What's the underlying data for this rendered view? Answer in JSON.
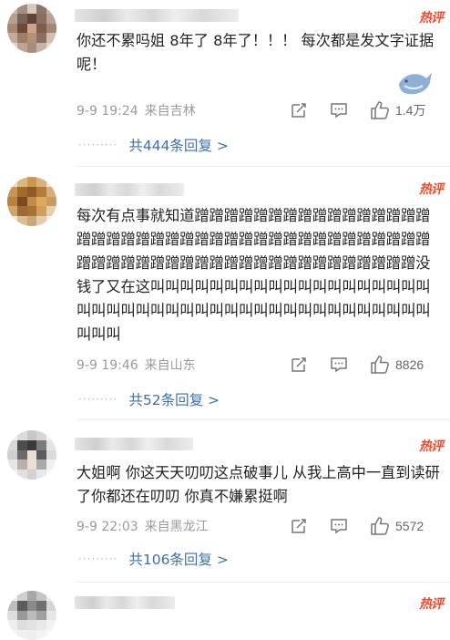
{
  "comments": [
    {
      "badge": "热评",
      "text": "你还不累吗姐 8年了 8年了！！！ 每次都是发文字证据呢！",
      "time": "9-9 19:24",
      "location": "来自吉林",
      "likes": "1.4万",
      "reply_text": "共444条回复 >",
      "avatar_icon": "blurred-avatar-icon"
    },
    {
      "badge": "热评",
      "text": "每次有点事就知道蹭蹭蹭蹭蹭蹭蹭蹭蹭蹭蹭蹭蹭蹭蹭蹭蹭蹭蹭蹭蹭蹭蹭蹭蹭蹭蹭蹭蹭蹭蹭蹭蹭蹭蹭蹭蹭蹭蹭蹭蹭蹭蹭蹭蹭蹭蹭蹭蹭蹭蹭蹭蹭蹭蹭蹭蹭蹭蹭蹭蹭蹭蹭没钱了又在这叫叫叫叫叫叫叫叫叫叫叫叫叫叫叫叫叫叫叫叫叫叫叫叫叫叫叫叫叫叫叫叫叫叫叫叫叫叫叫叫叫叫叫叫叫叫",
      "time": "9-9 19:46",
      "location": "来自山东",
      "likes": "8826",
      "reply_text": "共52条回复 >",
      "avatar_icon": "blurred-avatar-icon"
    },
    {
      "badge": "热评",
      "text": "大姐啊 你这天天叨叨这点破事儿 从我上高中一直到读研了你都还在叨叨 你真不嫌累挺啊",
      "time": "9-9 22:03",
      "location": "来自黑龙江",
      "likes": "5572",
      "reply_text": "共106条回复 >",
      "avatar_icon": "blurred-avatar-icon"
    },
    {
      "badge": "热评",
      "avatar_icon": "blurred-avatar-icon"
    }
  ],
  "icons": {
    "repost": "repost-icon",
    "comment": "comment-icon",
    "like": "thumbs-up-icon",
    "decoration": "whale-bird-icon"
  },
  "colors": {
    "badge": "#f04a2c",
    "reply_link": "#3d6fa8",
    "meta": "#9a9a9a",
    "text": "#222222"
  }
}
